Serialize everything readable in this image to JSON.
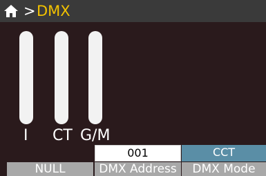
{
  "header": {
    "home_icon": "home-icon",
    "separator": ">",
    "title": "DMX",
    "title_color": "#f2c200"
  },
  "sliders": [
    {
      "label": "I",
      "level": 0
    },
    {
      "label": "CT",
      "level": 0
    },
    {
      "label": "G/M",
      "level": 0
    }
  ],
  "values": {
    "null": "",
    "dmx_address": "001",
    "dmx_mode": "CCT"
  },
  "softkeys": {
    "null": "NULL",
    "dmx_address": "DMX Address",
    "dmx_mode": "DMX Mode"
  },
  "colors": {
    "background": "#2a1a1c",
    "header": "#3a3a3a",
    "selected_value": "#5a8ea6",
    "softkey": "#a8a8a8"
  }
}
